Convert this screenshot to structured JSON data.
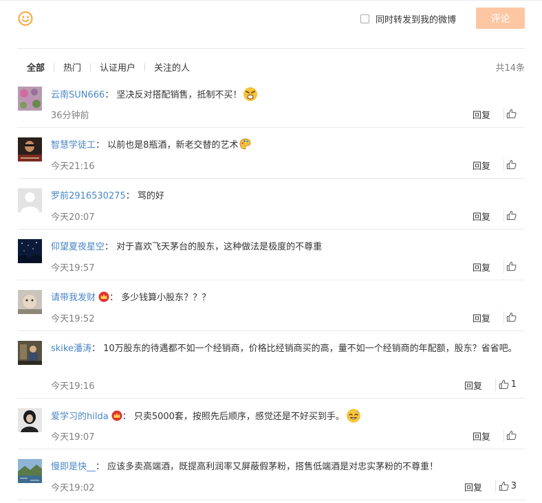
{
  "editor": {
    "forward_label": "同时转发到我的微博",
    "submit_label": "评论",
    "submit_color": "#fdc7a3"
  },
  "tabs": [
    {
      "label": "全部",
      "active": true
    },
    {
      "label": "热门",
      "active": false
    },
    {
      "label": "认证用户",
      "active": false
    },
    {
      "label": "关注的人",
      "active": false
    }
  ],
  "total": "共14条",
  "colors": {
    "username": "#4a86c6",
    "meta": "#808080",
    "text": "#333333"
  },
  "comments": [
    {
      "user": "云南SUN666",
      "crown": false,
      "sep": "：",
      "text": "坚决反对搭配销售，抵制不买！",
      "emoji": "angry-emoji",
      "time": "36分钟前",
      "reply": "回复",
      "likes": ""
    },
    {
      "user": "智慧学徒工",
      "crown": false,
      "sep": "：",
      "text": "以前也是8瓶酒，新老交替的艺术",
      "emoji": "palette-emoji",
      "time": "今天21:16",
      "reply": "回复",
      "likes": ""
    },
    {
      "user": "罗前2916530275",
      "crown": false,
      "sep": "：",
      "text": "骂的好",
      "emoji": "",
      "time": "今天20:07",
      "reply": "回复",
      "likes": ""
    },
    {
      "user": "仰望夏夜星空",
      "crown": false,
      "sep": "：",
      "text": "对于喜欢飞天茅台的股东，这种做法是极度的不尊重",
      "emoji": "",
      "time": "今天19:57",
      "reply": "回复",
      "likes": ""
    },
    {
      "user": "请带我发财",
      "crown": true,
      "sep": "：",
      "text": "多少钱算小股东？？？",
      "emoji": "",
      "time": "今天19:52",
      "reply": "回复",
      "likes": ""
    },
    {
      "user": "skike潘涛",
      "crown": false,
      "sep": "：",
      "text": "10万股东的待遇都不如一个经销商，价格比经销商买的高，量不如一个经销商的年配额，股东？省省吧。",
      "emoji": "",
      "time": "今天19:16",
      "reply": "回复",
      "likes": "1"
    },
    {
      "user": "爱学习的hilda",
      "crown": true,
      "sep": "：",
      "text": "只卖5000套，按照先后顺序，感觉还是不好买到手。",
      "emoji": "sweat-emoji",
      "time": "今天19:07",
      "reply": "回复",
      "likes": ""
    },
    {
      "user": "慢即是快__",
      "crown": false,
      "sep": "：",
      "text": "应该多卖高端酒，既提高利润率又屏蔽假茅粉，搭售低端酒是对忠实茅粉的不尊重！",
      "emoji": "",
      "time": "今天19:02",
      "reply": "回复",
      "likes": "3"
    }
  ]
}
